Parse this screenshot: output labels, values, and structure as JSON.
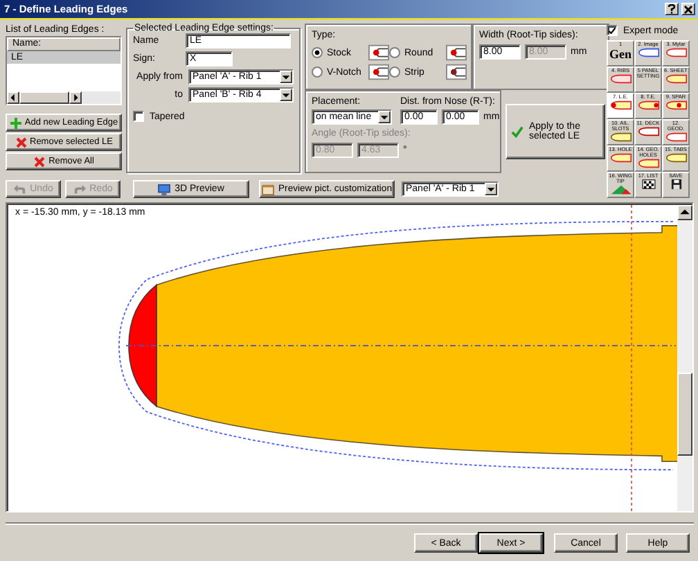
{
  "window": {
    "title": "7 - Define Leading Edges"
  },
  "list": {
    "label": "List of Leading Edges :",
    "column": "Name:",
    "rows": [
      {
        "name": "LE",
        "selected": true
      }
    ]
  },
  "list_buttons": [
    {
      "label": "Add new Leading Edge",
      "kind": "add"
    },
    {
      "label": "Remove selected LE",
      "kind": "remove"
    },
    {
      "label": "Remove All",
      "kind": "remove"
    }
  ],
  "settings": {
    "label": "Selected Leading Edge settings:",
    "name_label": "Name",
    "name_value": "LE",
    "sign_label": "Sign:",
    "sign_value": "X",
    "apply_from_label": "Apply from",
    "apply_from": "Panel 'A' - Rib 1",
    "to_label": "to",
    "apply_to": "Panel 'B' - Rib 4",
    "tapered": {
      "label": "Tapered",
      "checked": false
    }
  },
  "type": {
    "label": "Type:",
    "options": [
      {
        "label": "Stock",
        "selected": true
      },
      {
        "label": "Round",
        "selected": false
      },
      {
        "label": "V-Notch",
        "selected": false
      },
      {
        "label": "Strip",
        "selected": false
      }
    ]
  },
  "width": {
    "label": "Width (Root-Tip sides):",
    "root": "8.00",
    "tip": "8.00",
    "tip_disabled": true,
    "unit": "mm"
  },
  "placement": {
    "label": "Placement:",
    "value": "on mean line",
    "dist_label": "Dist. from Nose (R-T):",
    "dist_root": "0.00",
    "dist_tip": "0.00",
    "dist_unit": "mm",
    "angle_label": "Angle (Root-Tip sides):",
    "angle_root": "0.80",
    "angle_tip": "4.63",
    "angle_unit": "°",
    "angle_disabled": true
  },
  "apply_button": "Apply to the selected LE",
  "expert_mode": {
    "label": "Expert mode",
    "checked": true
  },
  "tools": [
    {
      "label": "1",
      "text": "Gen",
      "selected": false
    },
    {
      "label": "2. Image",
      "selected": false
    },
    {
      "label": "3. Mylar",
      "selected": false
    },
    {
      "label": "4. RIBS",
      "selected": false
    },
    {
      "label": "5 PANEL SETTING",
      "selected": false
    },
    {
      "label": "6. SHEET",
      "selected": false
    },
    {
      "label": "7. L.E.",
      "selected": true
    },
    {
      "label": "8. T.E.",
      "selected": false
    },
    {
      "label": "9. SPAR",
      "selected": false
    },
    {
      "label": "10. AIL. SLOTS",
      "selected": false
    },
    {
      "label": "11. DECK",
      "selected": false
    },
    {
      "label": "12. GEOD.",
      "selected": false
    },
    {
      "label": "13. HOLE",
      "selected": false
    },
    {
      "label": "14. GEO. HOLES",
      "selected": false
    },
    {
      "label": "15. TABS",
      "selected": false
    },
    {
      "label": "16. WING TIP",
      "selected": false
    },
    {
      "label": "17. LIST",
      "selected": false
    },
    {
      "label": "SAVE",
      "selected": false
    }
  ],
  "history": [
    {
      "label": "Undo",
      "disabled": true
    },
    {
      "label": "Redo",
      "disabled": true
    }
  ],
  "preview_buttons": [
    {
      "label": "3D Preview",
      "kind": "preview"
    },
    {
      "label": "Preview pict. customization",
      "kind": "customize"
    }
  ],
  "preview_panel": "Panel 'A' - Rib 1",
  "canvas": {
    "coordinates": "x = -15.30 mm, y = -18.13 mm"
  },
  "footer_buttons": [
    {
      "label": "< Back",
      "default": false
    },
    {
      "label": "Next >",
      "default": true
    },
    {
      "label": "Cancel",
      "default": false
    },
    {
      "label": "Help",
      "default": false
    }
  ]
}
